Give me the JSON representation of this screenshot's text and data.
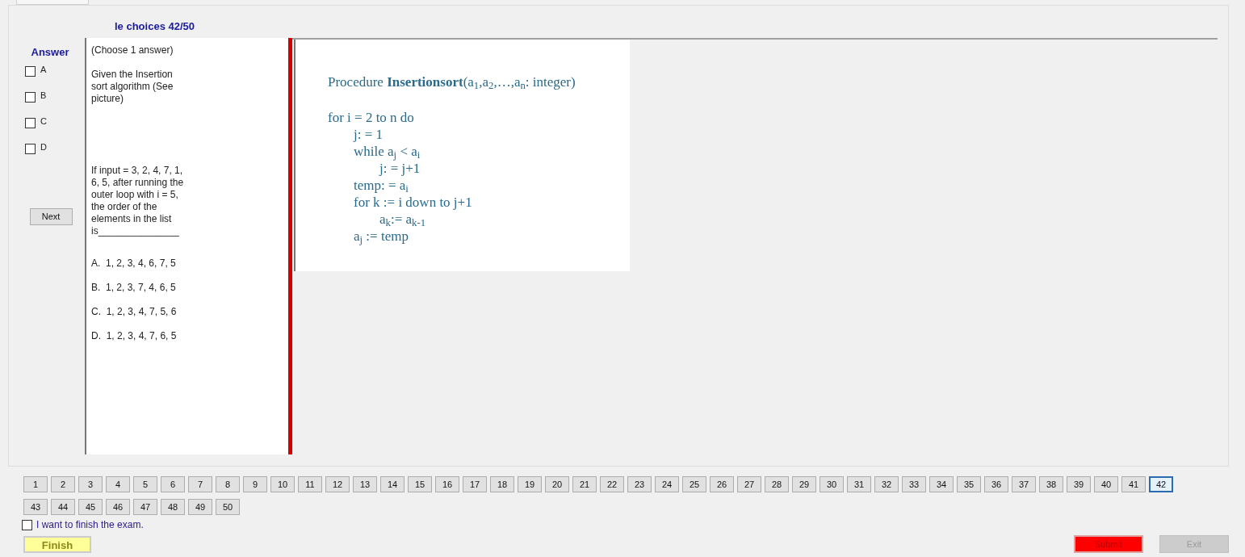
{
  "title": "le choices 42/50",
  "answer": {
    "heading": "Answer",
    "options": [
      {
        "label": "A",
        "checked": false
      },
      {
        "label": "B",
        "checked": false
      },
      {
        "label": "C",
        "checked": false
      },
      {
        "label": "D",
        "checked": false
      }
    ],
    "next_button": "Next"
  },
  "question": {
    "instruction": "(Choose 1 answer)",
    "intro": "Given the Insertion sort algorithm (See picture)",
    "prompt": "If input = 3, 2, 4, 7, 1, 6, 5, after running the outer loop with i = 5, the order of the elements in the list",
    "blank": "is_______________",
    "choices": [
      "A.  1, 2, 3, 4, 6, 7, 5",
      "B.  1, 2, 3, 7, 4, 6, 5",
      "C.  1, 2, 3, 4, 7, 5, 6",
      "D.  1, 2, 3, 4, 7, 6, 5"
    ]
  },
  "code": {
    "header": "Procedure **Insertionsort**(a$_{1}$,a$_{2}$,…,a$_{n}$: integer)",
    "lines": [
      {
        "text": "for i = 2 to n do",
        "children": [
          {
            "text": "j: = 1"
          },
          {
            "text": "while a$_{j}$ < a$_{i}$",
            "children": [
              {
                "text": "j: = j+1"
              }
            ]
          },
          {
            "text": "temp: = a$_{i}$"
          },
          {
            "text": "for k := i down to j+1",
            "children": [
              {
                "text": "a$_{k}$:= a$_{k-1}$"
              }
            ]
          },
          {
            "text": "a$_{j}$ := temp"
          }
        ]
      }
    ]
  },
  "question_buttons": [
    {
      "label": "1",
      "selected": false
    },
    {
      "label": "2",
      "selected": false
    },
    {
      "label": "3",
      "selected": false
    },
    {
      "label": "4",
      "selected": false
    },
    {
      "label": "5",
      "selected": false
    },
    {
      "label": "6",
      "selected": false
    },
    {
      "label": "7",
      "selected": false
    },
    {
      "label": "8",
      "selected": false
    },
    {
      "label": "9",
      "selected": false
    },
    {
      "label": "10",
      "selected": false
    },
    {
      "label": "11",
      "selected": false
    },
    {
      "label": "12",
      "selected": false
    },
    {
      "label": "13",
      "selected": false
    },
    {
      "label": "14",
      "selected": false
    },
    {
      "label": "15",
      "selected": false
    },
    {
      "label": "16",
      "selected": false
    },
    {
      "label": "17",
      "selected": false
    },
    {
      "label": "18",
      "selected": false
    },
    {
      "label": "19",
      "selected": false
    },
    {
      "label": "20",
      "selected": false
    },
    {
      "label": "21",
      "selected": false
    },
    {
      "label": "22",
      "selected": false
    },
    {
      "label": "23",
      "selected": false
    },
    {
      "label": "24",
      "selected": false
    },
    {
      "label": "25",
      "selected": false
    },
    {
      "label": "26",
      "selected": false
    },
    {
      "label": "27",
      "selected": false
    },
    {
      "label": "28",
      "selected": false
    },
    {
      "label": "29",
      "selected": false
    },
    {
      "label": "30",
      "selected": false
    },
    {
      "label": "31",
      "selected": false
    },
    {
      "label": "32",
      "selected": false
    },
    {
      "label": "33",
      "selected": false
    },
    {
      "label": "34",
      "selected": false
    },
    {
      "label": "35",
      "selected": false
    },
    {
      "label": "36",
      "selected": false
    },
    {
      "label": "37",
      "selected": false
    },
    {
      "label": "38",
      "selected": false
    },
    {
      "label": "39",
      "selected": false
    },
    {
      "label": "40",
      "selected": false
    },
    {
      "label": "41",
      "selected": false
    },
    {
      "label": "42",
      "selected": true
    },
    {
      "label": "43",
      "selected": false
    },
    {
      "label": "44",
      "selected": false
    },
    {
      "label": "45",
      "selected": false
    },
    {
      "label": "46",
      "selected": false
    },
    {
      "label": "47",
      "selected": false
    },
    {
      "label": "48",
      "selected": false
    },
    {
      "label": "49",
      "selected": false
    },
    {
      "label": "50",
      "selected": false
    }
  ],
  "finish_confirm": {
    "label": "I want to finish the exam.",
    "checked": false
  },
  "finish_button": "Finish",
  "submit_button": "Submit",
  "exit_button": {
    "label": "Exit",
    "disabled": true
  }
}
